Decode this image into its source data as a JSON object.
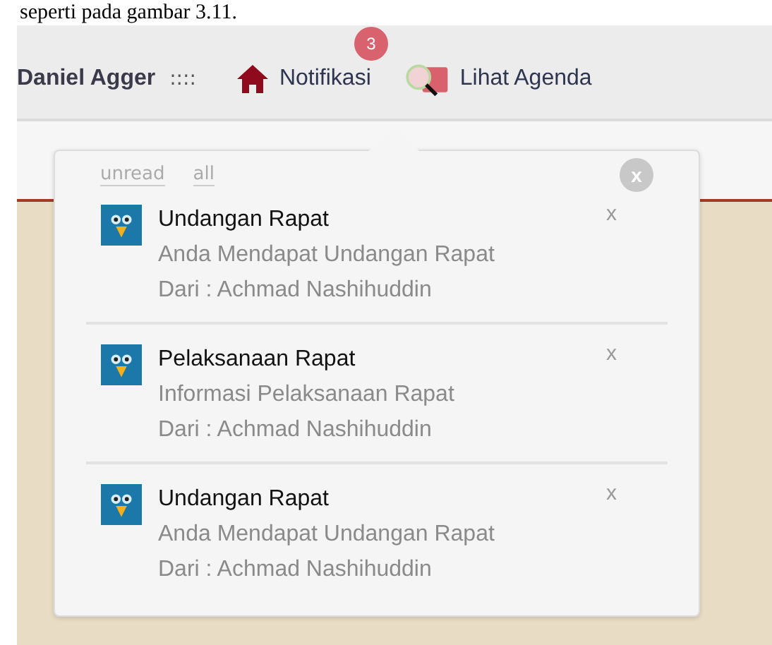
{
  "caption": "seperti pada gambar 3.11.",
  "header": {
    "user": "Daniel Agger",
    "separator": "::::",
    "nav": [
      {
        "kind": "notifications",
        "label": "Notifikasi",
        "badge": "3"
      },
      {
        "kind": "agenda",
        "label": "Lihat Agenda"
      }
    ]
  },
  "popup": {
    "filters": [
      "unread",
      "all"
    ],
    "close": "x",
    "items": [
      {
        "title": "Undangan Rapat",
        "message": "Anda Mendapat Undangan Rapat",
        "sender": "Dari : Achmad Nashihuddin",
        "dismiss": "x"
      },
      {
        "title": "Pelaksanaan Rapat",
        "message": "Informasi Pelaksanaan Rapat",
        "sender": "Dari : Achmad Nashihuddin",
        "dismiss": "x"
      },
      {
        "title": "Undangan Rapat",
        "message": "Anda Mendapat Undangan Rapat",
        "sender": "Dari : Achmad Nashihuddin",
        "dismiss": "x"
      }
    ]
  }
}
